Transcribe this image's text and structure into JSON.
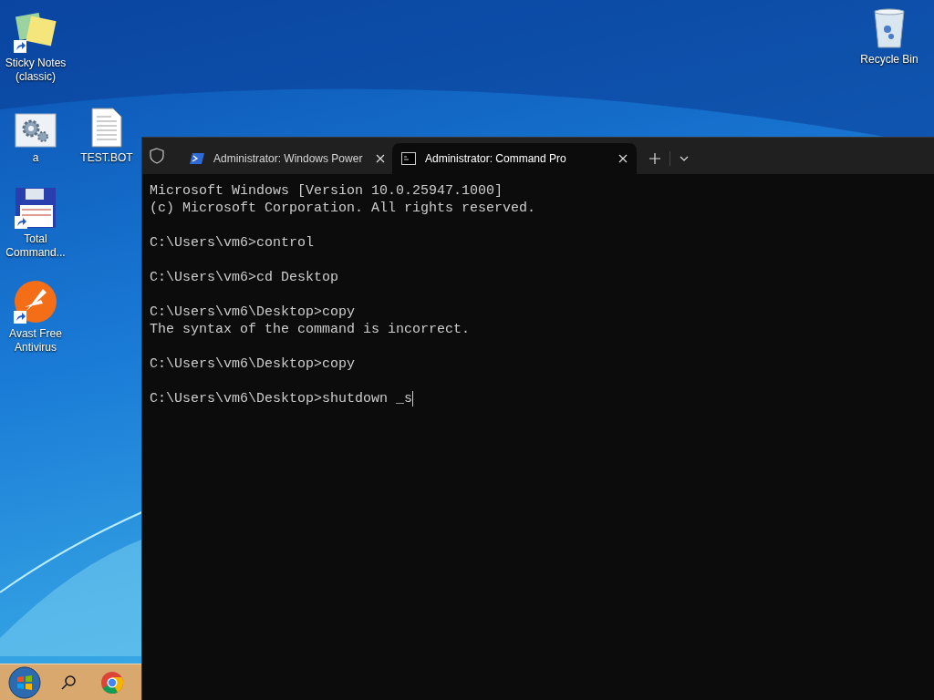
{
  "desktop_icons": [
    {
      "kind": "sticky",
      "label": "Sticky Notes (classic)",
      "shortcut": true
    },
    {
      "kind": "settings",
      "label": "a",
      "shortcut": false
    },
    {
      "kind": "document",
      "label": "TEST.BOT",
      "shortcut": false
    },
    {
      "kind": "floppy",
      "label": "Total Command...",
      "shortcut": true
    },
    {
      "kind": "avast",
      "label": "Avast Free Antivirus",
      "shortcut": true
    }
  ],
  "recycle_bin": {
    "label": "Recycle Bin"
  },
  "terminal": {
    "tabs": [
      {
        "kind": "powershell",
        "label": "Administrator: Windows Power",
        "selected": false
      },
      {
        "kind": "cmd",
        "label": "Administrator: Command Pro",
        "selected": true
      }
    ],
    "blocks": [
      [
        "Microsoft Windows [Version 10.0.25947.1000]",
        "(c) Microsoft Corporation. All rights reserved."
      ],
      [
        "C:\\Users\\vm6>control"
      ],
      [
        "C:\\Users\\vm6>cd Desktop"
      ],
      [
        "C:\\Users\\vm6\\Desktop>copy",
        "The syntax of the command is incorrect."
      ],
      [
        "C:\\Users\\vm6\\Desktop>copy"
      ],
      [
        "C:\\Users\\vm6\\Desktop>shutdown _s"
      ]
    ]
  },
  "taskbar": {
    "items": [
      {
        "kind": "start"
      },
      {
        "kind": "search"
      },
      {
        "kind": "chrome"
      }
    ]
  }
}
